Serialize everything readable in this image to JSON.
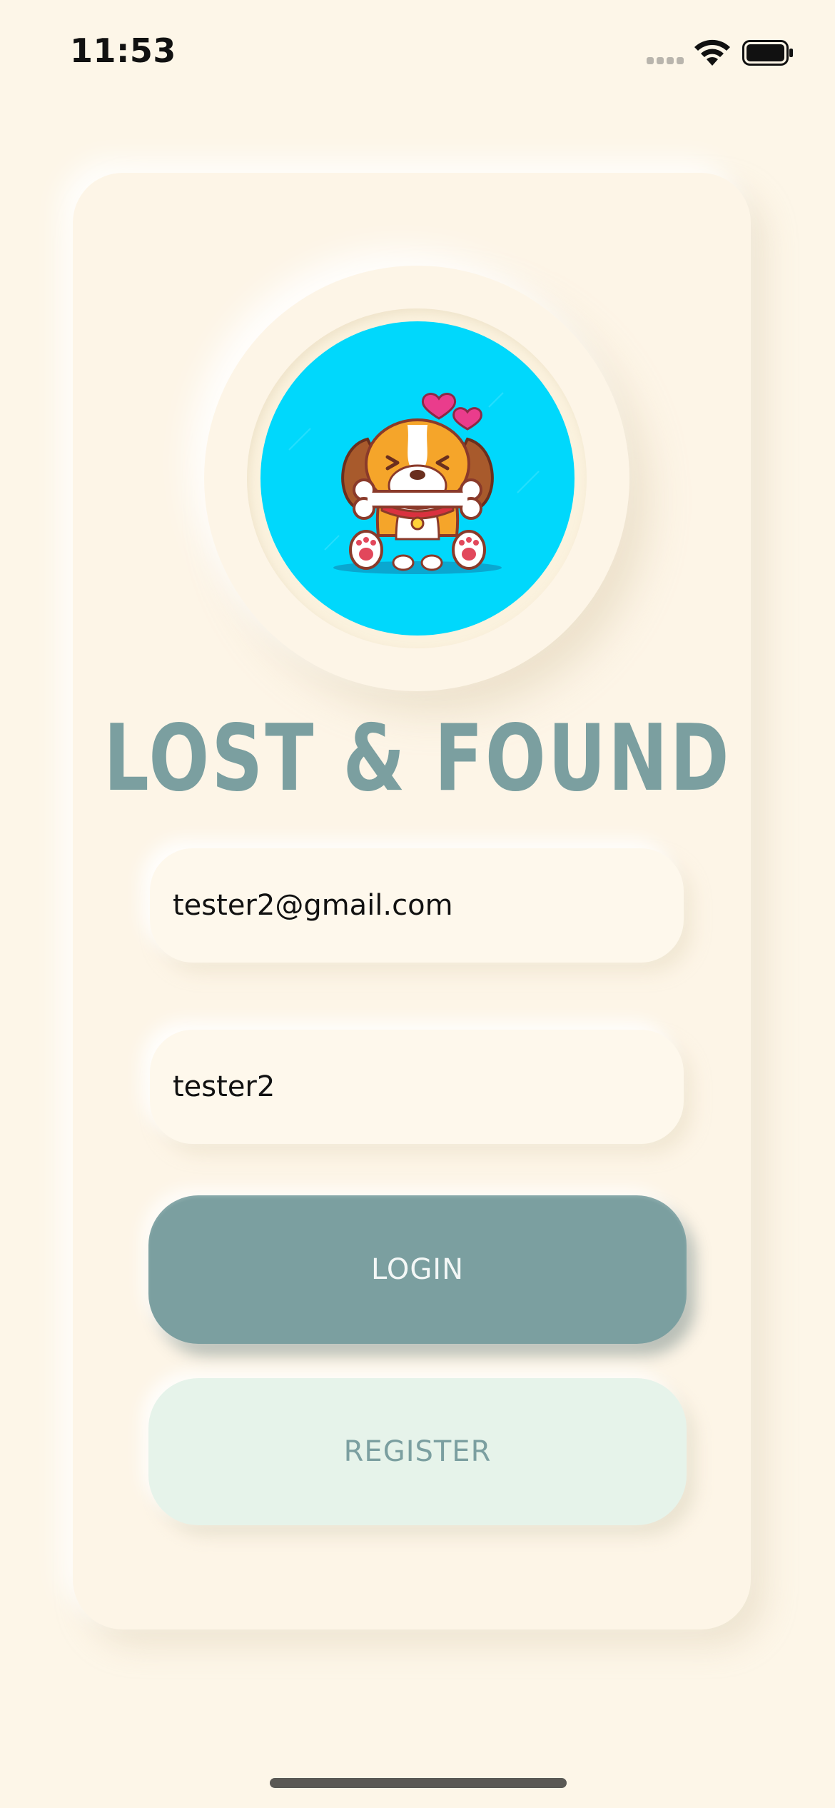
{
  "status_bar": {
    "time": "11:53",
    "signal_icon": "cellular-signal-icon",
    "wifi_icon": "wifi-icon",
    "battery_icon": "battery-full-icon"
  },
  "app": {
    "logo_image": "puppy-with-bone-avatar",
    "title": "LOST & FOUND"
  },
  "login_form": {
    "email_value": "tester2@gmail.com",
    "password_value": "tester2",
    "login_label": "LOGIN",
    "register_label": "REGISTER"
  },
  "colors": {
    "background": "#fdf6e8",
    "accent": "#7b9fa0",
    "avatar_bg": "#00d8fc",
    "register_bg": "#e6f3ea"
  }
}
